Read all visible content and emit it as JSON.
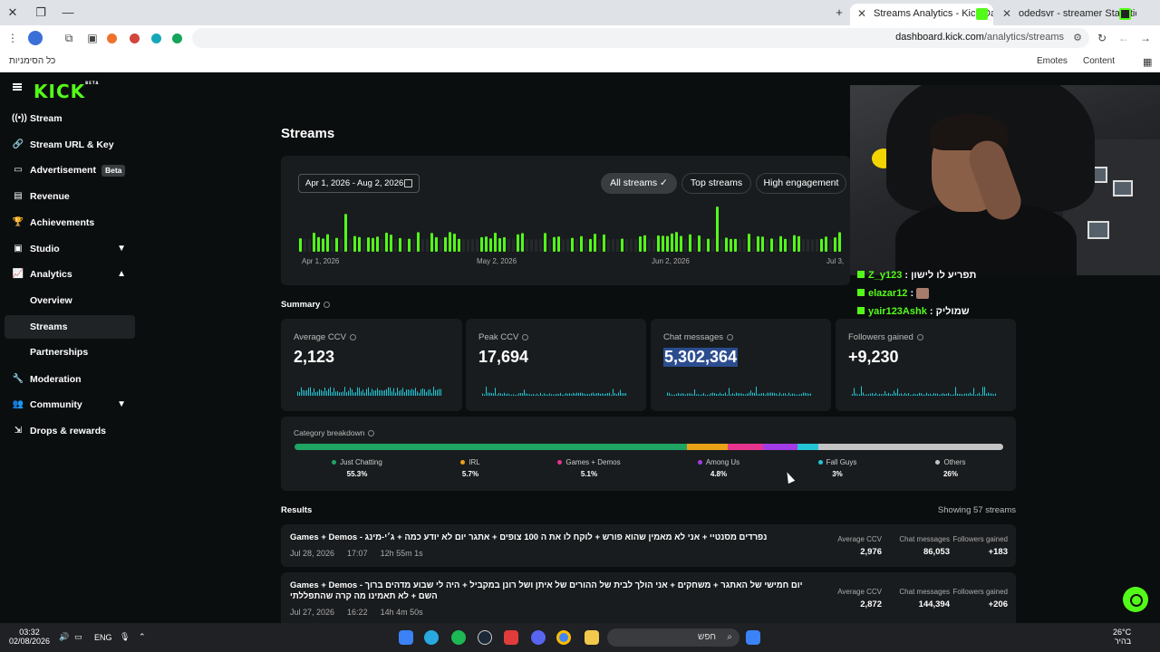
{
  "browser": {
    "tabs": [
      {
        "title": "Streams Analytics - Kick Dashb",
        "active": true
      },
      {
        "title": "odedsvr - streamer Statistics",
        "active": false
      }
    ],
    "url_host": "dashboard.kick.com",
    "url_path": "/analytics/streams",
    "bookmarks_left": "כל הסימניות",
    "bookmarks_right": [
      "Emotes",
      "Content"
    ]
  },
  "sidebar": {
    "brand": "KICK",
    "brand_tag": "BETA",
    "items": [
      {
        "label": "Stream",
        "icon": "broadcast-icon"
      },
      {
        "label": "Stream URL & Key",
        "icon": "link-icon"
      },
      {
        "label": "Advertisement",
        "icon": "ad-icon",
        "badge": "Beta"
      },
      {
        "label": "Revenue",
        "icon": "revenue-icon"
      },
      {
        "label": "Achievements",
        "icon": "trophy-icon"
      },
      {
        "label": "Studio",
        "icon": "studio-icon"
      },
      {
        "label": "Analytics",
        "icon": "analytics-icon"
      },
      {
        "label": "Moderation",
        "icon": "wrench-icon"
      },
      {
        "label": "Community",
        "icon": "community-icon"
      },
      {
        "label": "Drops & rewards",
        "icon": "drops-icon"
      }
    ],
    "analytics_sub": [
      "Overview",
      "Streams",
      "Partnerships"
    ]
  },
  "page": {
    "title": "Streams",
    "date_range": "Apr 1, 2026 - Aug 2, 2026",
    "filters": [
      "All streams",
      "Top streams",
      "High engagement"
    ],
    "axis_labels": [
      "Apr 1, 2026",
      "May 2, 2026",
      "Jun 2, 2026",
      "Jul 3,"
    ]
  },
  "summary": {
    "title": "Summary",
    "cards": [
      {
        "label": "Average CCV",
        "value": "2,123"
      },
      {
        "label": "Peak CCV",
        "value": "17,694"
      },
      {
        "label": "Chat messages",
        "value": "5,302,364"
      },
      {
        "label": "Followers gained",
        "value": "+9,230"
      }
    ]
  },
  "category": {
    "title": "Category breakdown",
    "items": [
      {
        "name": "Just Chatting",
        "pct": "55.3%",
        "share": 55.3,
        "color": "#1fa463"
      },
      {
        "name": "IRL",
        "pct": "5.7%",
        "share": 5.7,
        "color": "#e8a317"
      },
      {
        "name": "Games + Demos",
        "pct": "5.1%",
        "share": 5.1,
        "color": "#e7358f"
      },
      {
        "name": "Among Us",
        "pct": "4.8%",
        "share": 4.8,
        "color": "#a23ce6"
      },
      {
        "name": "Fall Guys",
        "pct": "3%",
        "share": 3,
        "color": "#22c6d6"
      },
      {
        "name": "Others",
        "pct": "26%",
        "share": 26,
        "color": "#c4c4c4"
      }
    ]
  },
  "results": {
    "title": "Results",
    "count": "Showing 57 streams",
    "stat_labels": [
      "Average CCV",
      "Chat messages",
      "Followers gained"
    ],
    "rows": [
      {
        "title": "Games + Demos - נפרדים מסנטיי + אני לא מאמין שהוא פורש + לוקח לו את ה 100 צופים + אתגר יום לא יודע כמה + ג׳י-מינג",
        "date": "Jul 28, 2026",
        "time": "17:07",
        "duration": "12h 55m 1s",
        "avg": "2,976",
        "chat": "86,053",
        "followers": "+183"
      },
      {
        "title": "Games + Demos - יום חמישי של האתגר + משחקים + אני הולך לבית של ההורים של איתן ושל רונן במקביל + היה לי שבוע מדהים ברוך השם + לא תאמינו מה קרה שהתפללתי",
        "date": "Jul 27, 2026",
        "time": "16:22",
        "duration": "14h 4m 50s",
        "avg": "2,872",
        "chat": "144,394",
        "followers": "+206"
      }
    ]
  },
  "chat_overlay": {
    "lines": [
      {
        "user": "Z_y123",
        "text": "תפריע לו לישון"
      },
      {
        "user": "elazar12",
        "text": ":"
      },
      {
        "user": "yair123Ashk",
        "text": ": שמוליק"
      }
    ]
  },
  "taskbar": {
    "time": "03:32",
    "date": "02/08/2026",
    "lang": "ENG",
    "search": "חפש",
    "weather_temp": "26°C",
    "weather_desc": "בהיר"
  }
}
